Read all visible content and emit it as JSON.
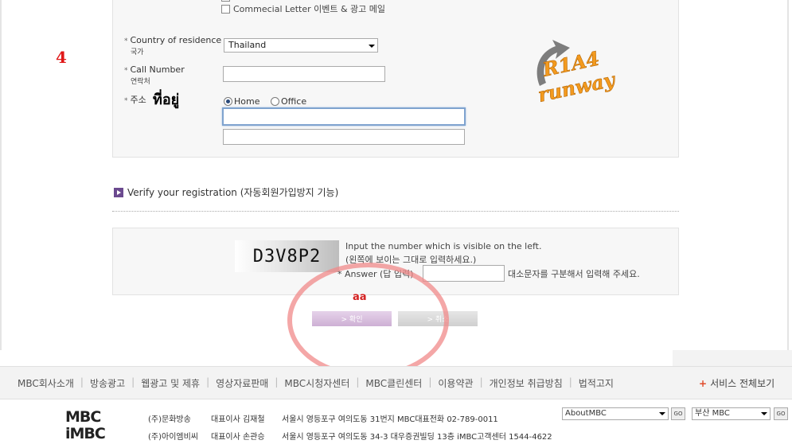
{
  "form": {
    "checkbox_label": "Commecial Letter 이벤트 & 광고 메일",
    "country_label": "Country of residence",
    "country_sub": "국가",
    "country_value": "Thailand",
    "call_label": "Call Number",
    "call_sub": "연락처",
    "address_label": "주소",
    "address_annotation": "ที่อยู่",
    "radio_home": "Home",
    "radio_office": "Office",
    "star": "*"
  },
  "annotation_four": "4",
  "logo_text_top": "R1A4",
  "logo_text_bottom": "runway",
  "verify": {
    "title": "Verify your registration (자동회원가입방지 기능)",
    "captcha_code": "D3V8P2",
    "instruction_1": "Input the number which is visible on the left.",
    "instruction_2": "(왼쪽에 보이는 그대로 입력하세요.)",
    "answer_label": "* Answer (답 입력)",
    "case_note": "대소문자를 구분해서 입력해 주세요.",
    "annotation_aa": "aa"
  },
  "buttons": {
    "confirm": "> 확인",
    "cancel": "> 취소"
  },
  "footer": {
    "nav": [
      "MBC회사소개",
      "방송광고",
      "웹광고 및 제휴",
      "영상자료판매",
      "MBC시청자센터",
      "MBC클린센터",
      "이용약관",
      "개인정보 취급방침",
      "법적고지"
    ],
    "service_all": "서비스 전체보기",
    "logo_line1": "MBC",
    "logo_line2": "iMBC",
    "corp1": {
      "name": "(주)문화방송",
      "ceo": "대표이사 김재철",
      "address": "서울시 영등포구 여의도동 31번지 MBC대표전화 02-789-0011"
    },
    "corp2": {
      "name": "(주)아이엠비씨",
      "ceo": "대표이사 손관승",
      "address": "서울시 영등포구 여의도동 34-3 대우증권빌딩 13층 iMBC고객센터 1544-4622"
    },
    "select1": "AboutMBC",
    "select2": "부산 MBC",
    "go": "GO"
  },
  "colors": {
    "annotation_red": "#e01818",
    "circle": "#f08a8a",
    "logo_orange": "#f39a1e"
  }
}
